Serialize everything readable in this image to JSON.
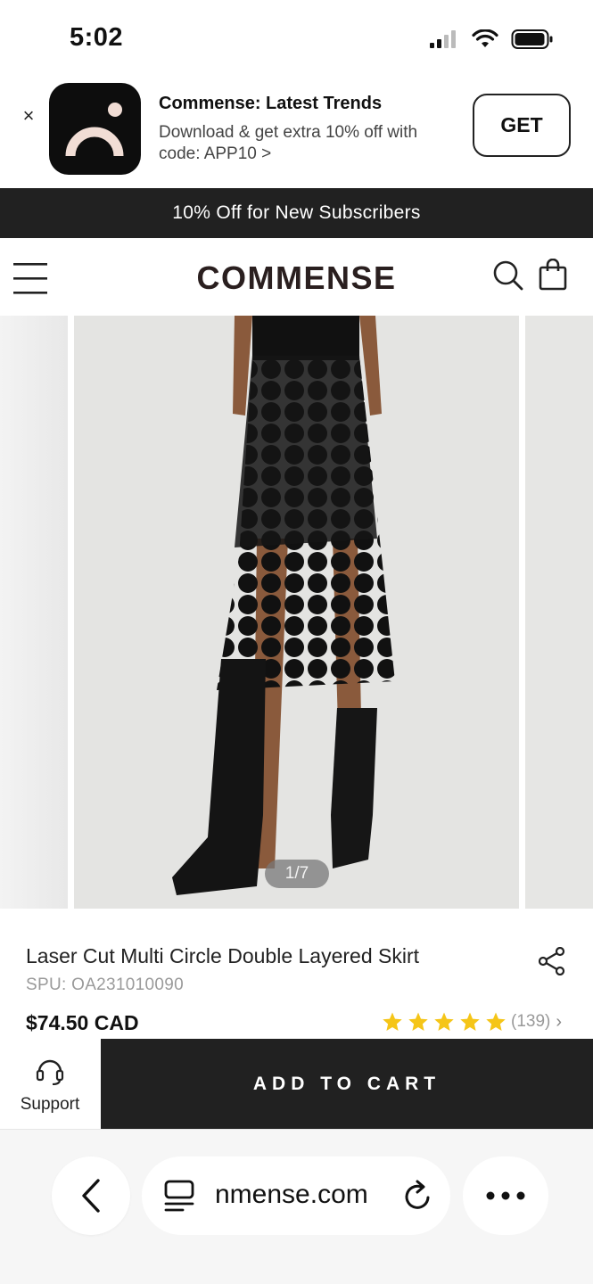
{
  "status_bar": {
    "time": "5:02"
  },
  "app_banner": {
    "close_glyph": "×",
    "title": "Commense: Latest Trends",
    "subtitle": "Download & get extra 10% off with code: APP10 >",
    "get_label": "GET"
  },
  "promo_bar": {
    "text": "10% Off for New Subscribers"
  },
  "header": {
    "logo": "COMMENSE"
  },
  "gallery": {
    "counter": "1/7"
  },
  "product": {
    "title": "Laser Cut Multi Circle Double Layered Skirt",
    "spu": "SPU: OA231010090",
    "price": "$74.50 CAD",
    "rating_stars": 5,
    "review_count": "(139)",
    "review_chevron": "›"
  },
  "actions": {
    "support_label": "Support",
    "add_to_cart_label": "ADD TO CART"
  },
  "browser": {
    "url": "nmense.com"
  },
  "colors": {
    "dark": "#212121",
    "star": "#f5c518",
    "muted": "#9a9a9a"
  }
}
